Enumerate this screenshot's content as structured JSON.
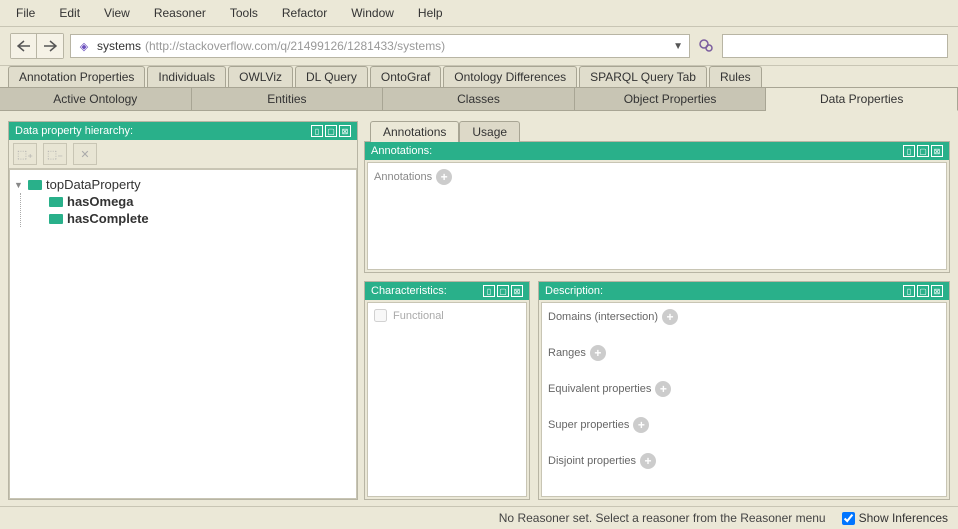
{
  "menu": {
    "items": [
      "File",
      "Edit",
      "View",
      "Reasoner",
      "Tools",
      "Refactor",
      "Window",
      "Help"
    ]
  },
  "toolbar": {
    "address": {
      "name": "systems",
      "url": "(http://stackoverflow.com/q/21499126/1281433/systems)"
    }
  },
  "tabs1": [
    "Annotation Properties",
    "Individuals",
    "OWLViz",
    "DL Query",
    "OntoGraf",
    "Ontology Differences",
    "SPARQL Query Tab",
    "Rules"
  ],
  "tabs2": [
    "Active Ontology",
    "Entities",
    "Classes",
    "Object Properties",
    "Data Properties"
  ],
  "activeTab2": 4,
  "left": {
    "title": "Data property hierarchy:",
    "tree": {
      "root": "topDataProperty",
      "children": [
        "hasOmega",
        "hasComplete"
      ]
    }
  },
  "right": {
    "annTabs": [
      "Annotations",
      "Usage"
    ],
    "annTitle": "Annotations:",
    "annLabel": "Annotations",
    "charTitle": "Characteristics:",
    "charItem": "Functional",
    "descTitle": "Description:",
    "descItems": [
      "Domains (intersection)",
      "Ranges",
      "Equivalent properties",
      "Super properties",
      "Disjoint properties"
    ]
  },
  "status": {
    "msg": "No Reasoner set. Select a reasoner from the Reasoner menu",
    "show": "Show Inferences"
  }
}
